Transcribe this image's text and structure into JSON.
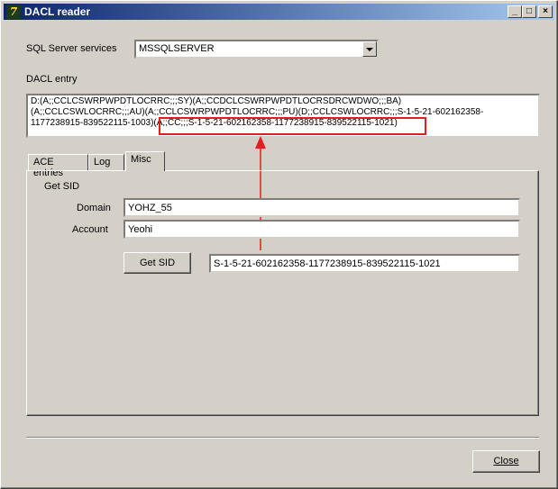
{
  "window": {
    "title": "DACL reader",
    "icon_name": "delphi-app-icon",
    "min_icon": "_",
    "max_icon": "□",
    "close_icon": "×"
  },
  "services": {
    "label": "SQL Server services",
    "selected": "MSSQLSERVER"
  },
  "dacl": {
    "label": "DACL entry",
    "lines": [
      "D:(A;;CCLCSWRPWPDTLOCRRC;;;SY)(A;;CCDCLCSWRPWPDTLOCRSDRCWDWO;;;BA)",
      "(A;;CCLCSWLOCRRC;;;AU)(A;;CCLCSWRPWPDTLOCRRC;;;PU)(D;;CCLCSWLOCRRC;;;S-1-5-21-602162358-",
      "1177238915-839522115-1003)(A;;CC;;;S-1-5-21-602162358-1177238915-839522115-1021)"
    ]
  },
  "tabs": [
    {
      "label": "ACE entries"
    },
    {
      "label": "Log"
    },
    {
      "label": "Misc"
    }
  ],
  "misc": {
    "group_label": "Get SID",
    "domain_label": "Domain",
    "domain_value": "YOHZ_55",
    "account_label": "Account",
    "account_value": "Yeohi",
    "get_sid_button": "Get SID",
    "sid_value": "S-1-5-21-602162358-1177238915-839522115-1021"
  },
  "close_button": "Close",
  "colors": {
    "highlight": "#e21f1f",
    "titlebar_start": "#0a246a",
    "titlebar_end": "#a6caf0"
  }
}
